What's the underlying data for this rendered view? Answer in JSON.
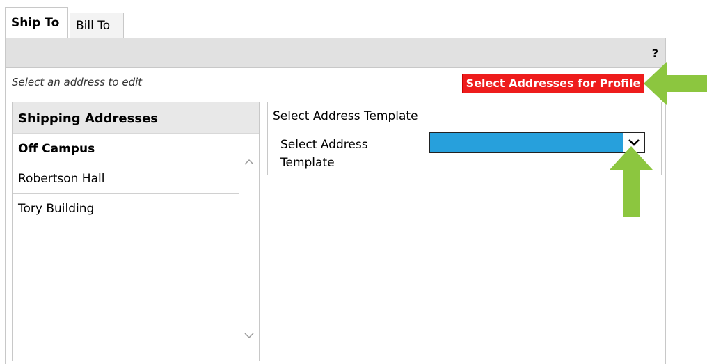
{
  "tabs": [
    {
      "label": "Ship To",
      "active": true
    },
    {
      "label": "Bill To",
      "active": false
    }
  ],
  "header": {
    "help_label": "?"
  },
  "hint": "Select an address to edit",
  "select_button": {
    "label": "Select Addresses for Profile",
    "color": "#ee1c1c"
  },
  "shipping_addresses": {
    "title": "Shipping Addresses",
    "items": [
      {
        "label": "Off Campus",
        "selected": true
      },
      {
        "label": "Robertson Hall",
        "selected": false
      },
      {
        "label": "Tory Building",
        "selected": false
      }
    ]
  },
  "template_panel": {
    "title": "Select Address Template",
    "field_label": "Select Address Template",
    "selected_value": "",
    "highlight_color": "#27a0dc"
  },
  "annotations": {
    "arrow_color": "#8cc63f"
  }
}
